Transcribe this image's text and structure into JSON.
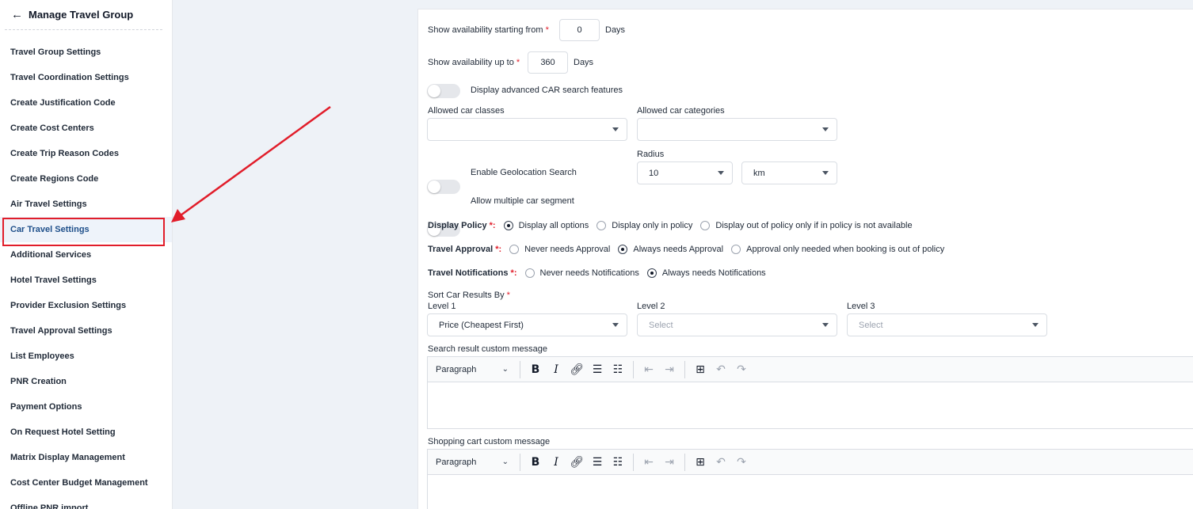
{
  "sidebar": {
    "title": "Manage Travel Group",
    "back_icon": "arrow-left-icon",
    "items": [
      {
        "label": "Travel Group Settings"
      },
      {
        "label": "Travel Coordination Settings"
      },
      {
        "label": "Create Justification Code"
      },
      {
        "label": "Create Cost Centers"
      },
      {
        "label": "Create Trip Reason Codes"
      },
      {
        "label": "Create Regions Code"
      },
      {
        "label": "Air Travel Settings"
      },
      {
        "label": "Car Travel Settings"
      },
      {
        "label": "Additional Services"
      },
      {
        "label": "Hotel Travel Settings"
      },
      {
        "label": "Provider Exclusion Settings"
      },
      {
        "label": "Travel Approval Settings"
      },
      {
        "label": "List Employees"
      },
      {
        "label": "PNR Creation"
      },
      {
        "label": "Payment Options"
      },
      {
        "label": "On Request Hotel Setting"
      },
      {
        "label": "Matrix Display Management"
      },
      {
        "label": "Cost Center Budget Management"
      },
      {
        "label": "Offline PNR import"
      }
    ],
    "active_item": "Car Travel Settings"
  },
  "form": {
    "avail_from": {
      "label": "Show availability starting from",
      "required": "*",
      "value": "0",
      "unit": "Days"
    },
    "avail_to": {
      "label": "Show availability up to",
      "required": "*",
      "value": "360",
      "unit": "Days"
    },
    "toggle_advanced": {
      "label": "Display advanced CAR search features"
    },
    "allowed_classes": {
      "label": "Allowed car classes",
      "value": ""
    },
    "allowed_categories": {
      "label": "Allowed car categories",
      "value": ""
    },
    "geo": {
      "label": "Enable Geolocation Search"
    },
    "radius": {
      "label": "Radius",
      "value": "10",
      "unit": "km"
    },
    "multi_segment": {
      "label": "Allow multiple car segment"
    },
    "display_policy": {
      "title": "Display Policy",
      "required": "*:",
      "options": [
        "Display all options",
        "Display only in policy",
        "Display out of policy only if in policy is not available"
      ],
      "selected": 0
    },
    "travel_approval": {
      "title": "Travel Approval",
      "required": "*:",
      "options": [
        "Never needs Approval",
        "Always needs Approval",
        "Approval only needed when booking is out of policy"
      ],
      "selected": 1
    },
    "travel_notifications": {
      "title": "Travel Notifications",
      "required": "*:",
      "options": [
        "Never needs Notifications",
        "Always needs Notifications"
      ],
      "selected": 1
    },
    "sort": {
      "label": "Sort Car Results By",
      "required": "*",
      "level1": {
        "label": "Level 1",
        "value": "Price (Cheapest First)"
      },
      "level2": {
        "label": "Level 2",
        "placeholder": "Select"
      },
      "level3": {
        "label": "Level 3",
        "placeholder": "Select"
      }
    },
    "search_message": {
      "label": "Search result custom message",
      "paragraph": "Paragraph"
    },
    "cart_message": {
      "label": "Shopping cart custom message",
      "paragraph": "Paragraph"
    }
  },
  "colors": {
    "accent": "#1e4f8a",
    "highlight": "#e11d2a",
    "background": "#eef2f7"
  }
}
